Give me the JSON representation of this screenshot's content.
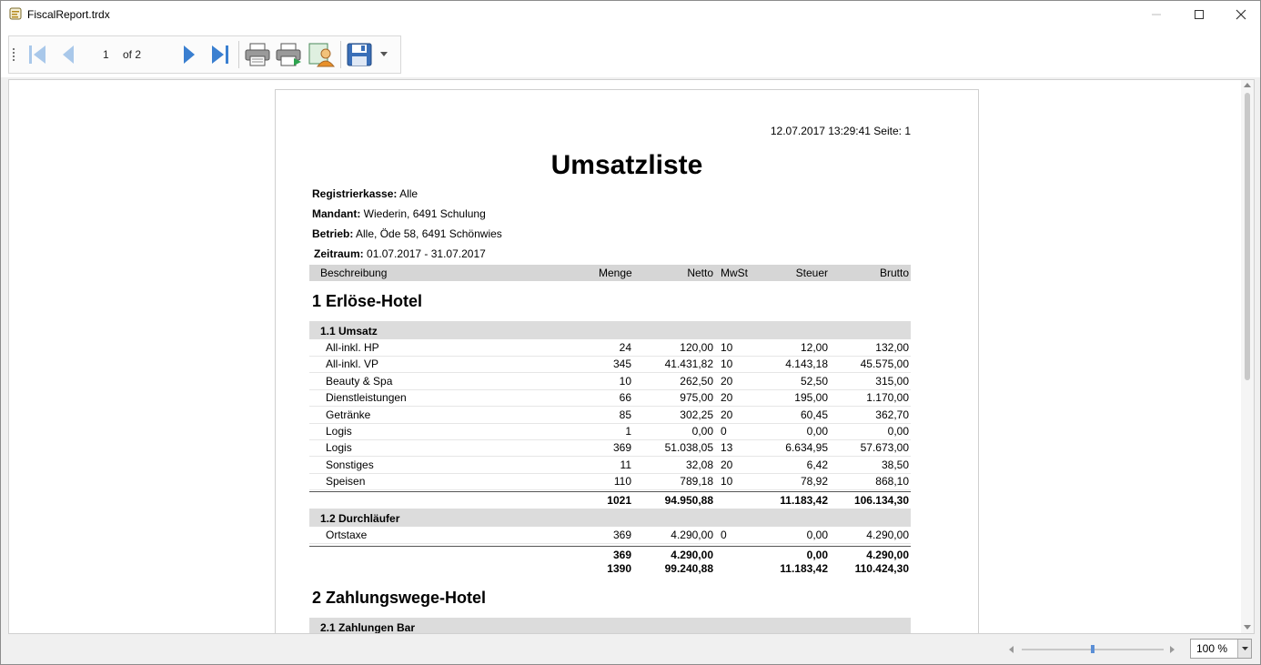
{
  "window": {
    "title": "FiscalReport.trdx"
  },
  "toolbar": {
    "page_current": "1",
    "page_total": "of 2"
  },
  "report": {
    "timestamp": "12.07.2017 13:29:41  Seite: 1",
    "title": "Umsatzliste",
    "meta": [
      {
        "label": "Registrierkasse:",
        "value": "Alle"
      },
      {
        "label": "Mandant:",
        "value": "Wiederin, 6491 Schulung"
      },
      {
        "label": "Betrieb:",
        "value": "Alle, Öde 58, 6491 Schönwies"
      },
      {
        "label": "Zeitraum:",
        "value": "01.07.2017 - 31.07.2017"
      }
    ],
    "columns": [
      "Beschreibung",
      "Menge",
      "Netto",
      "MwSt",
      "Steuer",
      "Brutto"
    ],
    "section1": {
      "title": "1 Erlöse-Hotel",
      "group1": {
        "title": "1.1 Umsatz",
        "rows": [
          [
            "All-inkl. HP",
            "24",
            "120,00",
            "10",
            "12,00",
            "132,00"
          ],
          [
            "All-inkl. VP",
            "345",
            "41.431,82",
            "10",
            "4.143,18",
            "45.575,00"
          ],
          [
            "Beauty & Spa",
            "10",
            "262,50",
            "20",
            "52,50",
            "315,00"
          ],
          [
            "Dienstleistungen",
            "66",
            "975,00",
            "20",
            "195,00",
            "1.170,00"
          ],
          [
            "Getränke",
            "85",
            "302,25",
            "20",
            "60,45",
            "362,70"
          ],
          [
            "Logis",
            "1",
            "0,00",
            "0",
            "0,00",
            "0,00"
          ],
          [
            "Logis",
            "369",
            "51.038,05",
            "13",
            "6.634,95",
            "57.673,00"
          ],
          [
            "Sonstiges",
            "11",
            "32,08",
            "20",
            "6,42",
            "38,50"
          ],
          [
            "Speisen",
            "110",
            "789,18",
            "10",
            "78,92",
            "868,10"
          ]
        ],
        "total": [
          "1021",
          "94.950,88",
          "11.183,42",
          "106.134,30"
        ]
      },
      "group2": {
        "title": "1.2 Durchläufer",
        "rows": [
          [
            "Ortstaxe",
            "369",
            "4.290,00",
            "0",
            "0,00",
            "4.290,00"
          ]
        ],
        "total": [
          "369",
          "4.290,00",
          "0,00",
          "4.290,00"
        ]
      },
      "total": [
        "1390",
        "99.240,88",
        "11.183,42",
        "110.424,30"
      ]
    },
    "section2": {
      "title": "2 Zahlungswege-Hotel",
      "group1": {
        "title": "2.1 Zahlungen Bar"
      }
    }
  },
  "status": {
    "zoom": "100 %",
    "zoom_fraction": 0.5
  }
}
